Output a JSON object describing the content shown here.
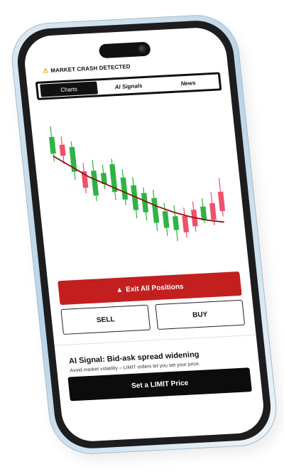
{
  "status_banner": {
    "icon": "warning-icon",
    "text": "MARKET CRASH DETECTED",
    "icon_color": "#e7a500"
  },
  "tabs": [
    {
      "label": "Charts",
      "active": true
    },
    {
      "label": "AI Signals",
      "active": false
    },
    {
      "label": "News",
      "active": false
    }
  ],
  "chart_data": {
    "type": "candlestick",
    "colors": {
      "up": "#2fb344",
      "down": "#f0506a",
      "trend": "#8b1111"
    },
    "candles": [
      {
        "open": 80,
        "close": 92,
        "high": 100,
        "low": 74
      },
      {
        "open": 86,
        "close": 78,
        "high": 92,
        "low": 72
      },
      {
        "open": 66,
        "close": 84,
        "high": 88,
        "low": 60
      },
      {
        "open": 66,
        "close": 54,
        "high": 72,
        "low": 50
      },
      {
        "open": 48,
        "close": 66,
        "high": 74,
        "low": 44
      },
      {
        "open": 56,
        "close": 64,
        "high": 70,
        "low": 52
      },
      {
        "open": 50,
        "close": 70,
        "high": 74,
        "low": 44
      },
      {
        "open": 44,
        "close": 60,
        "high": 66,
        "low": 40
      },
      {
        "open": 36,
        "close": 54,
        "high": 60,
        "low": 30
      },
      {
        "open": 34,
        "close": 48,
        "high": 52,
        "low": 28
      },
      {
        "open": 26,
        "close": 44,
        "high": 50,
        "low": 20
      },
      {
        "open": 22,
        "close": 34,
        "high": 40,
        "low": 16
      },
      {
        "open": 20,
        "close": 30,
        "high": 38,
        "low": 12
      },
      {
        "open": 30,
        "close": 18,
        "high": 36,
        "low": 14
      },
      {
        "open": 34,
        "close": 22,
        "high": 40,
        "low": 18
      },
      {
        "open": 26,
        "close": 36,
        "high": 42,
        "low": 24
      },
      {
        "open": 38,
        "close": 26,
        "high": 46,
        "low": 22
      },
      {
        "open": 46,
        "close": 32,
        "high": 56,
        "low": 28
      }
    ],
    "trend": [
      78,
      70,
      62,
      56,
      50,
      44,
      38,
      33,
      29,
      26,
      24
    ]
  },
  "actions": {
    "exit_all": {
      "icon": "warning-icon",
      "label": "Exit All Positions",
      "color": "#c41f1f"
    },
    "sell_label": "SELL",
    "buy_label": "BUY"
  },
  "ai_signal": {
    "title": "AI Signal: Bid-ask spread widening",
    "subtitle": "Avoid market volatility – LIMIT orders let you set your price.",
    "button_label": "Set a LIMIT Price"
  }
}
